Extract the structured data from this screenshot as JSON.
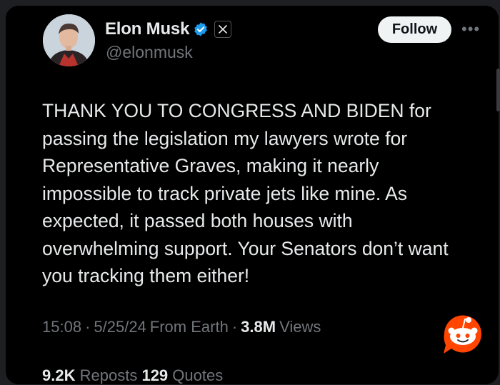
{
  "author": {
    "name": "Elon Musk",
    "handle": "@elonmusk",
    "verified_badge_color": "#1d9bf0",
    "affiliation_badge": "x-logo-icon"
  },
  "actions": {
    "follow_label": "Follow",
    "more_label": "•••"
  },
  "tweet": {
    "text": "THANK YOU TO CONGRESS AND BIDEN for passing the legislation my lawyers wrote for Representative Graves, making it nearly impossible to track private jets like mine. As expected, it passed both houses with overwhelming support. Your Senators don’t want you tracking them either!"
  },
  "meta": {
    "time": "15:08",
    "sep1": "·",
    "date": "5/25/24",
    "source": "From Earth",
    "sep2": "·",
    "views_count": "3.8M",
    "views_label": "Views"
  },
  "stats": {
    "reposts_count": "9.2K",
    "reposts_label": "Reposts",
    "quotes_count": "129",
    "quotes_label": "Quotes"
  },
  "colors": {
    "background": "#000000",
    "text_primary": "#e7e9ea",
    "text_secondary": "#71767b",
    "reddit_orange": "#ff4500"
  },
  "overlay": {
    "icon": "reddit-snoo-icon"
  }
}
